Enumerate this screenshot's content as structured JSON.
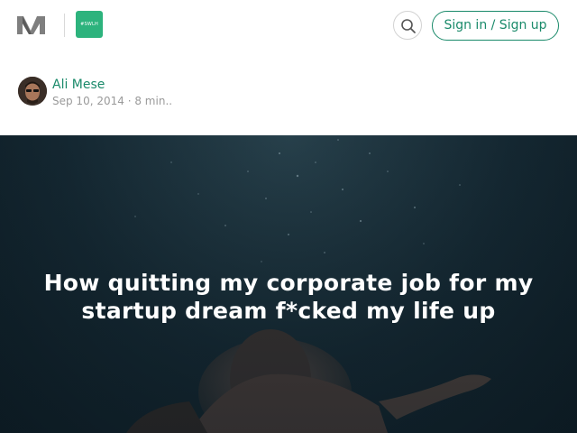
{
  "header": {
    "logo_icon": "medium-logo-icon",
    "publication_label": "#SWLH",
    "search_icon": "search-icon",
    "signin_label": "Sign in / Sign up"
  },
  "author": {
    "name": "Ali Mese",
    "date": "Sep 10, 2014",
    "separator": "·",
    "read_time": "8 min.."
  },
  "article": {
    "title": "How quitting my corporate job for my startup dream f*cked my life up"
  },
  "colors": {
    "accent": "#1a8a6a",
    "publication": "#2db37d",
    "hero_bg": "#142731"
  }
}
